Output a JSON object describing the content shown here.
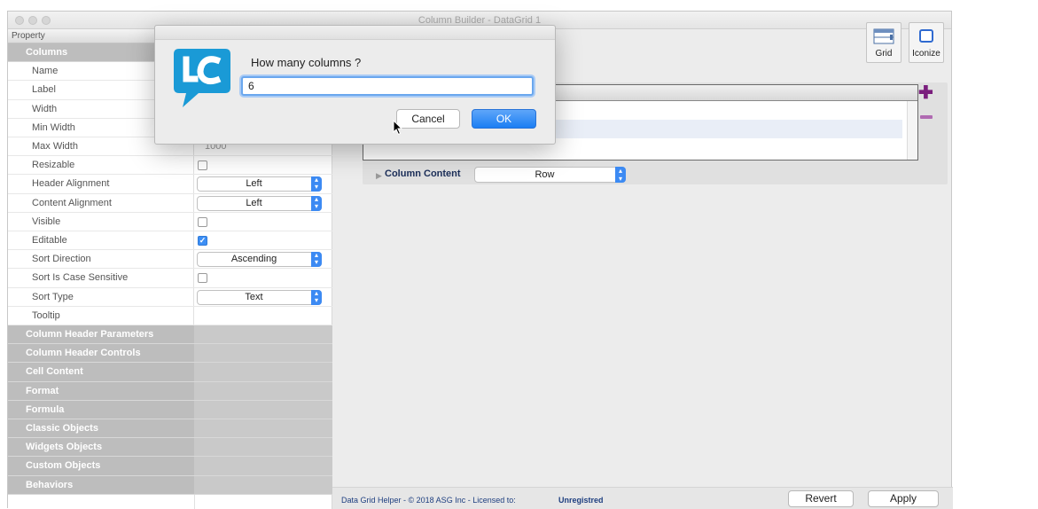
{
  "window": {
    "title": "Column Builder - DataGrid 1"
  },
  "property_panel": {
    "header": "Property",
    "columns_section": "Columns",
    "rows": [
      {
        "label": "Name",
        "type": "text",
        "value": ""
      },
      {
        "label": "Label",
        "type": "text",
        "value": ""
      },
      {
        "label": "Width",
        "type": "text",
        "value": ""
      },
      {
        "label": "Min Width",
        "type": "text",
        "value": ""
      },
      {
        "label": "Max Width",
        "type": "text",
        "value": "1000"
      },
      {
        "label": "Resizable",
        "type": "checkbox",
        "checked": false
      },
      {
        "label": "Header Alignment",
        "type": "select",
        "value": "Left"
      },
      {
        "label": "Content Alignment",
        "type": "select",
        "value": "Left"
      },
      {
        "label": "Visible",
        "type": "checkbox",
        "checked": false
      },
      {
        "label": "Editable",
        "type": "checkbox",
        "checked": true
      },
      {
        "label": "Sort Direction",
        "type": "select",
        "value": "Ascending"
      },
      {
        "label": "Sort Is Case Sensitive",
        "type": "checkbox",
        "checked": false
      },
      {
        "label": "Sort Type",
        "type": "select",
        "value": "Text"
      },
      {
        "label": "Tooltip",
        "type": "text",
        "value": ""
      }
    ],
    "sections": [
      "Column Header Parameters",
      "Column Header Controls",
      "Cell Content",
      "Format",
      "Formula",
      "Classic Objects",
      "Widgets Objects",
      "Custom Objects",
      "Behaviors"
    ]
  },
  "toolbar": {
    "grid_label": "Grid",
    "iconize_label": "Iconize"
  },
  "column_content": {
    "label": "Column Content",
    "value": "Row"
  },
  "status": {
    "text": "Data Grid Helper - © 2018 ASG Inc - Licensed to:",
    "license": "Unregistred",
    "revert_label": "Revert",
    "apply_label": "Apply"
  },
  "dialog": {
    "prompt": "How many columns ?",
    "input_value": "6",
    "cancel_label": "Cancel",
    "ok_label": "OK"
  },
  "colors": {
    "accent": "#3c8af3",
    "section_bg": "#c9c9c9",
    "logo": "#1a9ad6",
    "add_button": "#7a1e7d"
  }
}
